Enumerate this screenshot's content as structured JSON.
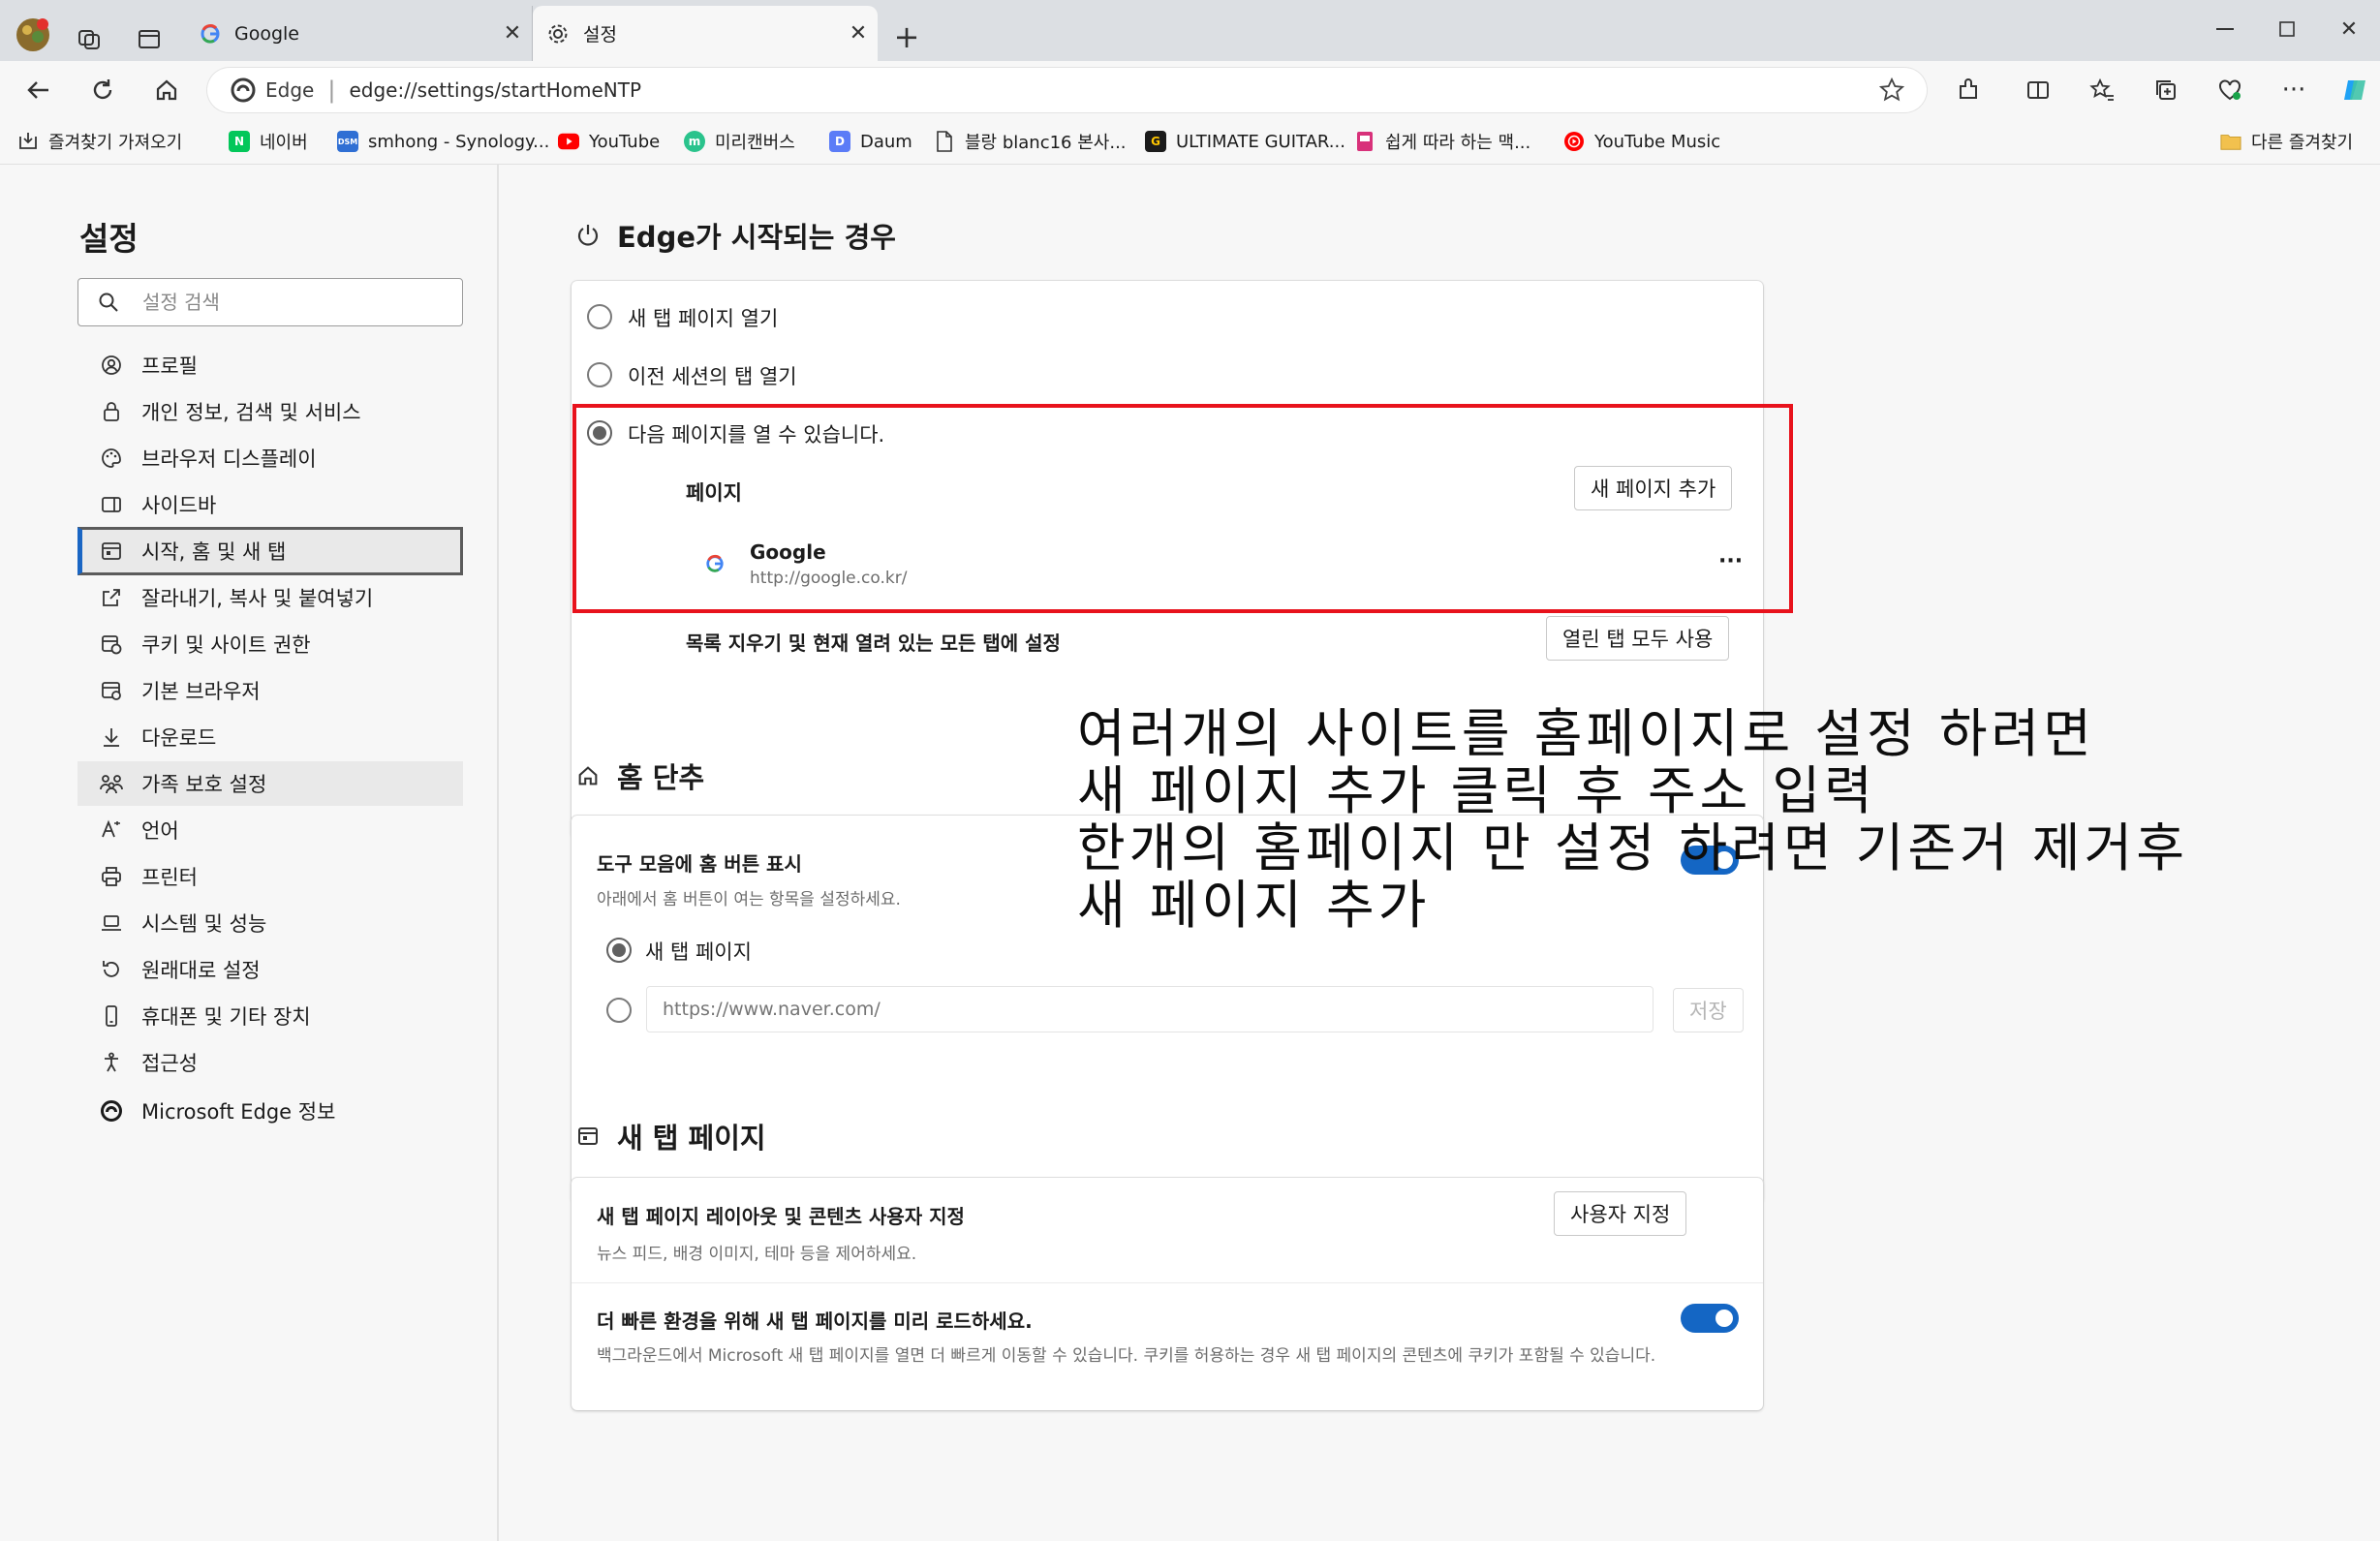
{
  "tabs": [
    {
      "label": "Google",
      "icon": "google-g-icon"
    },
    {
      "label": "설정",
      "icon": "gear-icon",
      "active": true
    }
  ],
  "address_bar": {
    "site_label": "Edge",
    "url": "edge://settings/startHomeNTP"
  },
  "favorites": [
    {
      "label": "즐겨찾기 가져오기",
      "icon": "import-favorites-icon"
    },
    {
      "label": "네이버",
      "icon": "naver-icon",
      "icon_text": "N",
      "color": "#03c75a"
    },
    {
      "label": "smhong - Synology...",
      "icon": "dsm-icon",
      "icon_text": "DSM",
      "color": "#2f6fd4"
    },
    {
      "label": "YouTube",
      "icon": "youtube-icon",
      "color": "#ff0000"
    },
    {
      "label": "미리캔버스",
      "icon": "miricanvas-icon",
      "icon_text": "m",
      "color": "#2ac38c"
    },
    {
      "label": "Daum",
      "icon": "daum-icon",
      "icon_text": "D",
      "color": "#5b7cf7"
    },
    {
      "label": "블랑 blanc16 본사...",
      "icon": "page-icon"
    },
    {
      "label": "ULTIMATE GUITAR...",
      "icon": "ultimate-guitar-icon",
      "icon_text": "G",
      "color": "#1b1b1b"
    },
    {
      "label": "쉽게 따라 하는 맥...",
      "icon": "mac-guide-icon",
      "color": "#d8317a"
    },
    {
      "label": "YouTube Music",
      "icon": "youtube-music-icon",
      "color": "#ff0000"
    },
    {
      "label": "다른 즐겨찾기",
      "icon": "folder-icon",
      "color": "#f2c14e"
    }
  ],
  "sidebar": {
    "title": "설정",
    "search_placeholder": "설정 검색",
    "items": [
      {
        "label": "프로필",
        "icon": "profile-icon"
      },
      {
        "label": "개인 정보, 검색 및 서비스",
        "icon": "lock-icon"
      },
      {
        "label": "브라우저 디스플레이",
        "icon": "palette-icon"
      },
      {
        "label": "사이드바",
        "icon": "sidebar-icon"
      },
      {
        "label": "시작, 홈 및 새 탭",
        "icon": "start-home-icon",
        "state": "selected"
      },
      {
        "label": "잘라내기, 복사 및 붙여넣기",
        "icon": "share-icon"
      },
      {
        "label": "쿠키 및 사이트 권한",
        "icon": "cookie-icon"
      },
      {
        "label": "기본 브라우저",
        "icon": "default-browser-icon"
      },
      {
        "label": "다운로드",
        "icon": "download-icon"
      },
      {
        "label": "가족 보호 설정",
        "icon": "family-icon",
        "state": "hovered"
      },
      {
        "label": "언어",
        "icon": "language-icon"
      },
      {
        "label": "프린터",
        "icon": "printer-icon"
      },
      {
        "label": "시스템 및 성능",
        "icon": "laptop-icon"
      },
      {
        "label": "원래대로 설정",
        "icon": "reset-icon"
      },
      {
        "label": "휴대폰 및 기타 장치",
        "icon": "phone-icon"
      },
      {
        "label": "접근성",
        "icon": "accessibility-icon"
      },
      {
        "label": "Microsoft Edge 정보",
        "icon": "edge-icon"
      }
    ]
  },
  "startup": {
    "title": "Edge가 시작되는 경우",
    "options": [
      "새 탭 페이지 열기",
      "이전 세션의 탭 열기",
      "다음 페이지를 열 수 있습니다."
    ],
    "pages_label": "페이지",
    "add_page_button": "새 페이지 추가",
    "page": {
      "name": "Google",
      "url": "http://google.co.kr/"
    },
    "page_more": "···",
    "clear_label": "목록 지우기 및 현재 열려 있는 모든 탭에 설정",
    "use_all_tabs_button": "열린 탭 모두 사용"
  },
  "home": {
    "title": "홈 단추",
    "show_button_label": "도구 모음에 홈 버튼 표시",
    "show_button_desc": "아래에서 홈 버튼이 여는 항목을 설정하세요.",
    "option_new_tab": "새 탭 페이지",
    "url_placeholder": "https://www.naver.com/",
    "save_button": "저장"
  },
  "new_tab": {
    "title": "새 탭 페이지",
    "customize_label": "새 탭 페이지 레이아웃 및 콘텐츠 사용자 지정",
    "customize_desc": "뉴스 피드, 배경 이미지, 테마 등을 제어하세요.",
    "customize_button": "사용자 지정",
    "preload_label": "더 빠른 환경을 위해 새 탭 페이지를 미리 로드하세요.",
    "preload_desc": "백그라운드에서 Microsoft 새 탭 페이지를 열면 더 빠르게 이동할 수 있습니다. 쿠키를 허용하는 경우 새 탭 페이지의 콘텐츠에 쿠키가 포함될 수 있습니다.",
    "preload_enabled": true
  },
  "annotation": {
    "lines": [
      "여러개의 사이트를 홈페이지로 설정 하려면",
      "새 페이지 추가 클릭 후 주소 입력",
      "한개의 홈페이지 만 설정 하려면 기존거 제거후",
      "새 페이지 추가"
    ],
    "highlight_color": "#e8121c"
  },
  "colors": {
    "accent": "#1466c4",
    "selected_border": "#5b5b5b"
  }
}
